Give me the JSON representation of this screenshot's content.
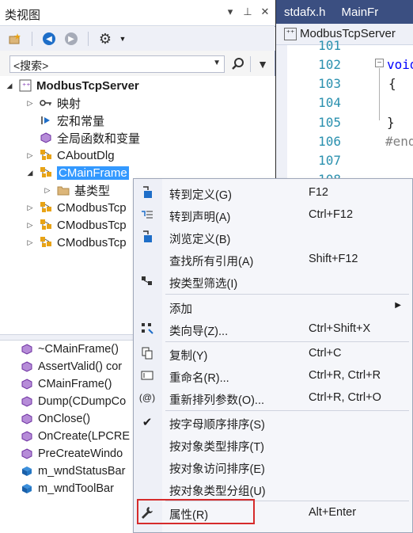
{
  "classview": {
    "title": "类视图",
    "title_buttons": [
      "▾",
      "⊥",
      "✕"
    ],
    "search_placeholder": "<搜索>",
    "tree": [
      {
        "label": "ModbusTcpServer",
        "bold": true,
        "expander": "◢",
        "icon": "project-icon"
      },
      {
        "label": "映射",
        "expander": "▷",
        "icon": "map-icon"
      },
      {
        "label": "宏和常量",
        "expander": "",
        "icon": "macro-icon"
      },
      {
        "label": "全局函数和变量",
        "expander": "",
        "icon": "globals-icon"
      },
      {
        "label": "CAboutDlg",
        "expander": "▷",
        "icon": "class-icon"
      },
      {
        "label": "CMainFrame",
        "expander": "◢",
        "icon": "class-icon",
        "selected": true
      },
      {
        "label": "基类型",
        "expander": "▷",
        "icon": "folder-icon"
      },
      {
        "label": "CModbusTcp",
        "expander": "▷",
        "icon": "class-icon"
      },
      {
        "label": "CModbusTcp",
        "expander": "▷",
        "icon": "class-icon"
      },
      {
        "label": "CModbusTcp",
        "expander": "▷",
        "icon": "class-icon"
      }
    ],
    "members": [
      {
        "label": "~CMainFrame()",
        "icon": "method-icon"
      },
      {
        "label": "AssertValid() cor",
        "icon": "method-icon"
      },
      {
        "label": "CMainFrame()",
        "icon": "method-icon"
      },
      {
        "label": "Dump(CDumpCo",
        "icon": "method-icon"
      },
      {
        "label": "OnClose()",
        "icon": "method-icon"
      },
      {
        "label": "OnCreate(LPCRE",
        "icon": "method-icon"
      },
      {
        "label": "PreCreateWindo",
        "icon": "method-icon"
      },
      {
        "label": "m_wndStatusBar",
        "icon": "field-icon"
      },
      {
        "label": "m_wndToolBar",
        "icon": "field-icon"
      }
    ]
  },
  "editor": {
    "tabs": [
      "stdafx.h",
      "MainFr"
    ],
    "navbar_label": "ModbusTcpServer",
    "line_numbers": [
      "101",
      "102",
      "103",
      "104",
      "105",
      "106",
      "107",
      "108"
    ],
    "code_lines": [
      "",
      "void",
      "{",
      "",
      "}",
      "#end",
      "",
      ""
    ]
  },
  "context_menu": {
    "items": [
      {
        "label": "转到定义(G)",
        "shortcut": "F12",
        "icon": "goto-definition-icon"
      },
      {
        "label": "转到声明(A)",
        "shortcut": "Ctrl+F12",
        "icon": "goto-declaration-icon"
      },
      {
        "label": "浏览定义(B)",
        "shortcut": "",
        "icon": "browse-definition-icon"
      },
      {
        "label": "查找所有引用(A)",
        "shortcut": "Shift+F12",
        "icon": ""
      },
      {
        "label": "按类型筛选(I)",
        "shortcut": "",
        "icon": "filter-type-icon"
      },
      {
        "label": "添加",
        "shortcut": "",
        "icon": "",
        "submenu": true
      },
      {
        "label": "类向导(Z)...",
        "shortcut": "Ctrl+Shift+X",
        "icon": "class-wizard-icon"
      },
      {
        "label": "复制(Y)",
        "shortcut": "Ctrl+C",
        "icon": "copy-icon"
      },
      {
        "label": "重命名(R)...",
        "shortcut": "Ctrl+R, Ctrl+R",
        "icon": "rename-icon"
      },
      {
        "label": "重新排列参数(O)...",
        "shortcut": "Ctrl+R, Ctrl+O",
        "icon": "reorder-params-icon"
      },
      {
        "label": "按字母顺序排序(S)",
        "shortcut": "",
        "icon": "checkmark-icon",
        "checked": true
      },
      {
        "label": "按对象类型排序(T)",
        "shortcut": "",
        "icon": ""
      },
      {
        "label": "按对象访问排序(E)",
        "shortcut": "",
        "icon": ""
      },
      {
        "label": "按对象类型分组(U)",
        "shortcut": "",
        "icon": ""
      },
      {
        "label": "属性(R)",
        "shortcut": "Alt+Enter",
        "icon": "wrench-icon"
      }
    ]
  },
  "colors": {
    "selection": "#3399ff",
    "tab_bar": "#3b4f81",
    "highlight_box": "#d62b2b"
  }
}
